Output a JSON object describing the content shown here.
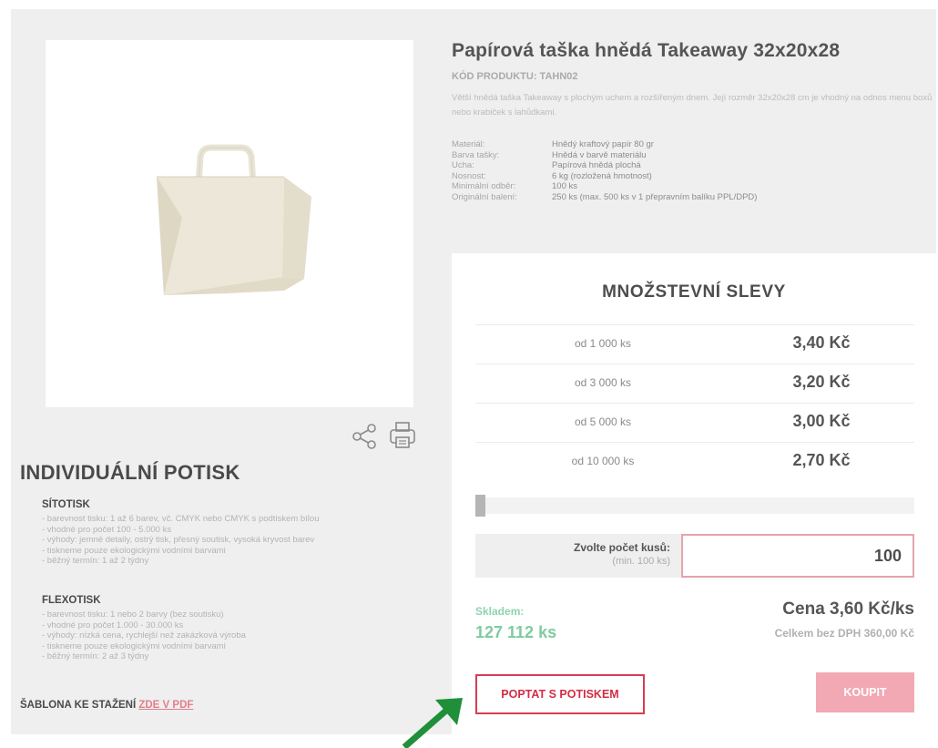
{
  "product": {
    "title": "Papírová taška hnědá Takeaway 32x20x28",
    "code": "KÓD PRODUKTU: TAHN02",
    "description": "Větší hnědá taška Takeaway s plochým uchem a rozšířeným dnem. Její rozměr 32x20x28 cm je vhodný na odnos menu boxů nebo krabiček s lahůdkami.",
    "image_alt": "paper-bag-photo",
    "specs": [
      {
        "key": "Materiál:",
        "value": "Hnědý kraftový papír 80 gr"
      },
      {
        "key": "Barva tašky:",
        "value": "Hnědá v barvě materiálu"
      },
      {
        "key": "Ucha:",
        "value": "Papírová hnědá plochá"
      },
      {
        "key": "Nosnost:",
        "value": "6 kg (rozložená hmotnost)"
      },
      {
        "key": "Minimální odběr:",
        "value": "100 ks"
      },
      {
        "key": "Originální balení:",
        "value": "250 ks (max. 500 ks v 1 přepravním balíku PPL/DPD)"
      }
    ]
  },
  "actions": {
    "share_icon": "share-icon",
    "print_icon": "printer-icon"
  },
  "potisk": {
    "title": "INDIVIDUÁLNÍ POTISK",
    "methods": [
      {
        "name": "SÍTOTISK",
        "lines": [
          "- barevnost tisku: 1 až 6 barev, vč. CMYK nebo CMYK s podtiskem bílou",
          "- vhodné pro počet 100 - 5.000 ks",
          "- výhody: jemné detaily, ostrý tisk, přesný soutisk, vysoká kryvost barev",
          "- tiskneme pouze ekologickými vodními barvami",
          "- běžný termín: 1 až 2 týdny"
        ]
      },
      {
        "name": "FLEXOTISK",
        "lines": [
          "- barevnost tisku: 1 nebo 2 barvy (bez soutisku)",
          "- vhodné pro počet 1.000 - 30.000 ks",
          "- výhody: nízká cena, rychlejší než zakázková výroba",
          "- tiskneme pouze ekologickými vodními barvami",
          "- běžný termín: 2 až 3 týdny"
        ]
      }
    ],
    "template_label": "ŠABLONA KE STAŽENÍ",
    "template_link": "ZDE V PDF"
  },
  "discounts": {
    "title": "MNOŽSTEVNÍ SLEVY",
    "tiers": [
      {
        "qty": "od 1 000 ks",
        "price": "3,40 Kč"
      },
      {
        "qty": "od 3 000 ks",
        "price": "3,20 Kč"
      },
      {
        "qty": "od 5 000 ks",
        "price": "3,00 Kč"
      },
      {
        "qty": "od 10 000 ks",
        "price": "2,70 Kč"
      }
    ],
    "slider_position": 0
  },
  "order": {
    "qty_label": "Zvolte počet kusů:",
    "qty_hint": "(min. 100 ks)",
    "qty_value": "100",
    "stock_label": "Skladem:",
    "stock_value": "127 112 ks",
    "price_each": "Cena 3,60 Kč/ks",
    "price_total": "Celkem bez DPH 360,00 Kč",
    "inquire_button": "POPTAT S POTISKEM",
    "buy_button": "KOUPIT"
  },
  "colors": {
    "accent_red": "#d83c52",
    "buy_pink": "#f2a9b3",
    "stock_green": "#7fcba0",
    "link_pink": "#e27f8c",
    "arrow_green": "#1f8f3a"
  }
}
